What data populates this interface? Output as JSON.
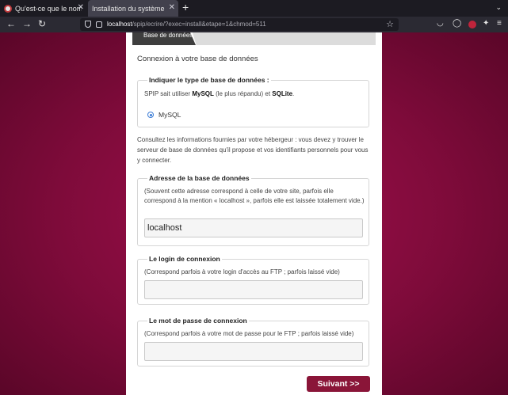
{
  "browser": {
    "tabs": [
      {
        "title": "Qu'est-ce que le nom du",
        "active": false
      },
      {
        "title": "Installation du système de p",
        "active": true
      }
    ],
    "url_host": "localhost",
    "url_rest": "/spip/ecrire/?exec=install&etape=1&chmod=511"
  },
  "steps": [
    "Base de données",
    "",
    "",
    ""
  ],
  "page": {
    "heading": "Connexion à votre base de données",
    "db_type": {
      "legend": "Indiquer le type de base de données :",
      "text_prefix": "SPIP sait utiliser ",
      "mysql_bold": "MySQL",
      "text_mid": " (le plus répandu) et ",
      "sqlite_bold": "SQLite",
      "text_suffix": ".",
      "option_label": "MySQL"
    },
    "info": "Consultez les informations fournies par votre hébergeur : vous devez y trouver le serveur de base de données qu'il propose et vos identifiants personnels pour vous y connecter.",
    "address": {
      "legend": "Adresse de la base de données",
      "help": "(Souvent cette adresse correspond à celle de votre site, parfois elle correspond à la mention « localhost », parfois elle est laissée totalement vide.)",
      "value": "localhost"
    },
    "login": {
      "legend": "Le login de connexion",
      "help": "(Correspond parfois à votre login d'accès au FTP ; parfois laissé vide)",
      "value": ""
    },
    "password": {
      "legend": "Le mot de passe de connexion",
      "help": "(Correspond parfois à votre mot de passe pour le FTP ; parfois laissé vide)",
      "value": ""
    },
    "submit_label": "Suivant >>"
  },
  "icons": {
    "back": "←",
    "forward": "→",
    "reload": "↻",
    "star": "☆",
    "close": "✕",
    "new_tab": "+"
  },
  "colors": {
    "accent": "#8a1538",
    "background": "#7e0b3a",
    "radio": "#3a7bd5"
  }
}
